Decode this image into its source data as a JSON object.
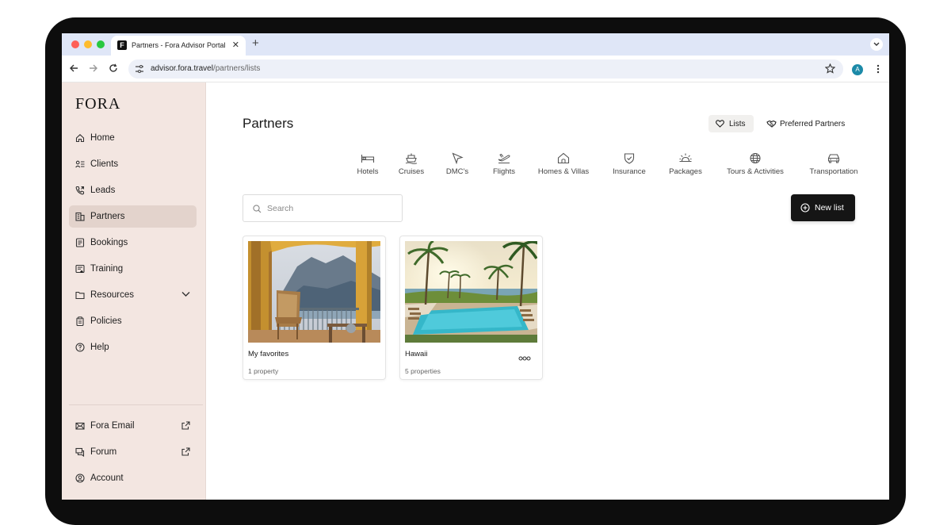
{
  "browser": {
    "tab_title": "Partners - Fora Advisor Portal",
    "tab_favicon": "F",
    "url_host": "advisor.fora.travel",
    "url_path": "/partners/lists",
    "profile_initial": "A"
  },
  "sidebar": {
    "logo": "FORA",
    "items": [
      {
        "label": "Home",
        "icon": "home-icon"
      },
      {
        "label": "Clients",
        "icon": "clients-icon"
      },
      {
        "label": "Leads",
        "icon": "phone-icon"
      },
      {
        "label": "Partners",
        "icon": "building-icon",
        "active": true
      },
      {
        "label": "Bookings",
        "icon": "document-icon"
      },
      {
        "label": "Training",
        "icon": "training-icon"
      },
      {
        "label": "Resources",
        "icon": "folder-icon",
        "expandable": true
      },
      {
        "label": "Policies",
        "icon": "clipboard-icon"
      },
      {
        "label": "Help",
        "icon": "help-icon"
      }
    ],
    "bottom_items": [
      {
        "label": "Fora Email",
        "icon": "mail-icon",
        "external": true
      },
      {
        "label": "Forum",
        "icon": "forum-icon",
        "external": true
      },
      {
        "label": "Account",
        "icon": "account-icon"
      }
    ]
  },
  "main": {
    "title": "Partners",
    "lists_button": "Lists",
    "preferred_button": "Preferred Partners",
    "categories": [
      {
        "label": "Hotels",
        "icon": "bed-icon"
      },
      {
        "label": "Cruises",
        "icon": "ship-icon"
      },
      {
        "label": "DMC's",
        "icon": "navigation-icon"
      },
      {
        "label": "Flights",
        "icon": "plane-icon"
      },
      {
        "label": "Homes & Villas",
        "icon": "house-icon"
      },
      {
        "label": "Insurance",
        "icon": "shield-icon"
      },
      {
        "label": "Packages",
        "icon": "sunrise-icon"
      },
      {
        "label": "Tours & Activities",
        "icon": "globe-icon"
      },
      {
        "label": "Transportation",
        "icon": "car-icon"
      }
    ],
    "search": {
      "placeholder": "Search",
      "value": ""
    },
    "new_list_button": "New list",
    "lists": [
      {
        "name": "My favorites",
        "count": "1 property"
      },
      {
        "name": "Hawaii",
        "count": "5 properties"
      }
    ]
  },
  "colors": {
    "sidebar_bg": "#f3e6e1",
    "active_item_bg": "#e3d3cc",
    "primary_button": "#151515",
    "tabbar_bg": "#dfe6f7"
  }
}
